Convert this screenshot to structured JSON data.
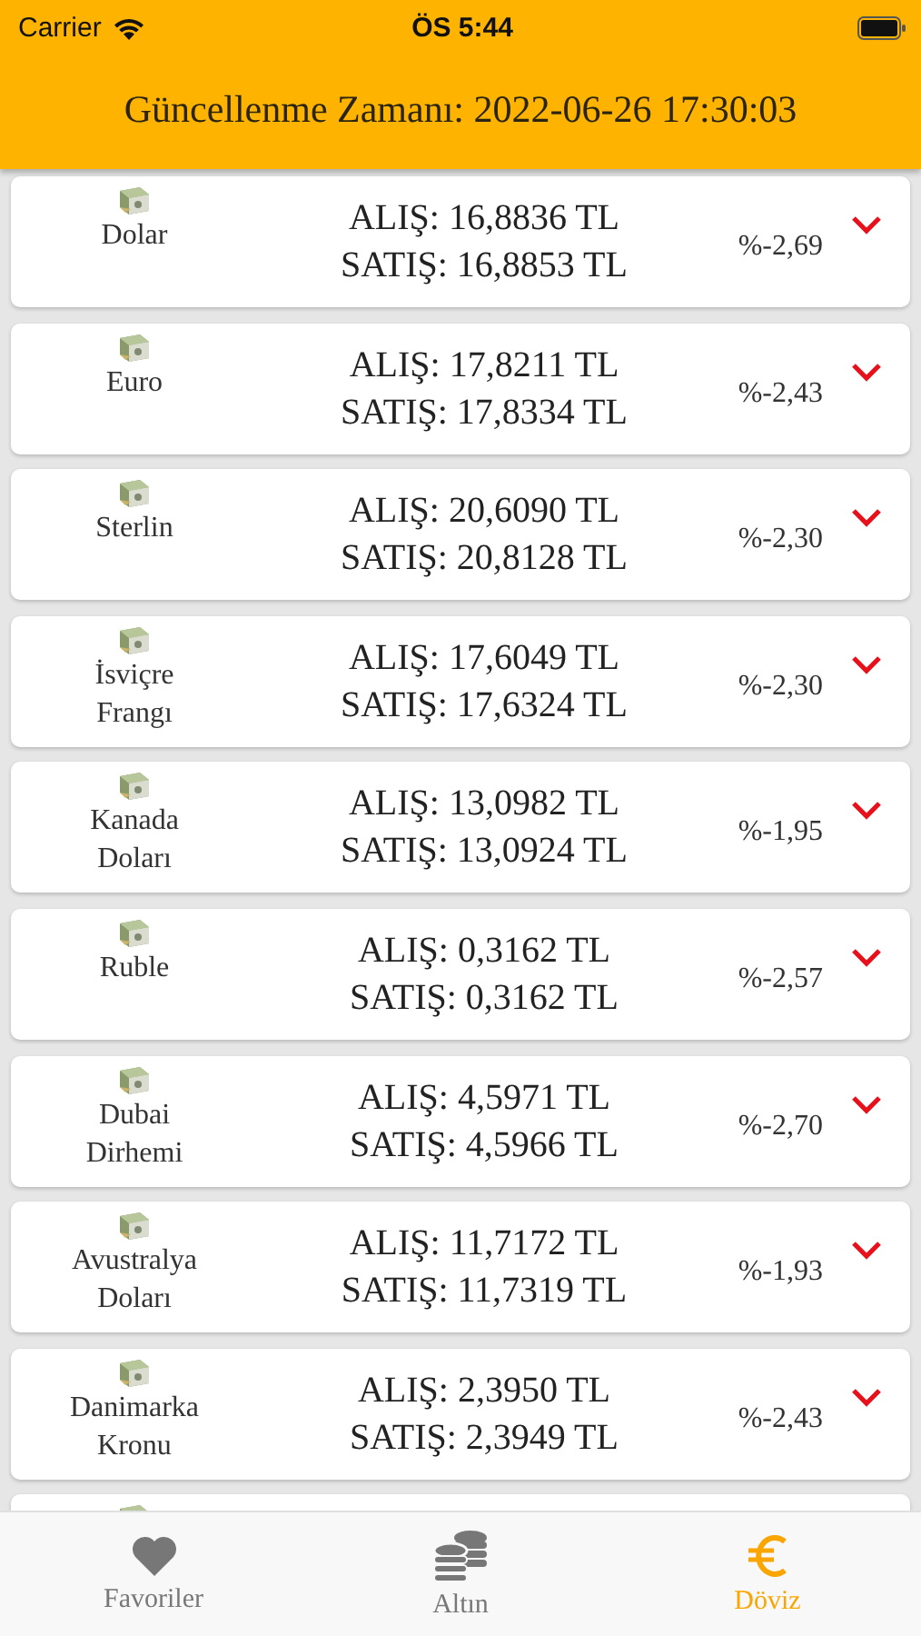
{
  "status_bar": {
    "carrier": "Carrier",
    "time": "ÖS 5:44"
  },
  "header": {
    "title": "Güncellenme Zamanı: 2022-06-26 17:30:03"
  },
  "rates": [
    {
      "name": "Dolar",
      "buy": "ALIŞ: 16,8836 TL",
      "sell": "SATIŞ: 16,8853 TL",
      "change": "%-2,69",
      "kind": "down"
    },
    {
      "name": "Euro",
      "buy": "ALIŞ: 17,8211 TL",
      "sell": "SATIŞ: 17,8334 TL",
      "change": "%-2,43",
      "kind": "down"
    },
    {
      "name": "Sterlin",
      "buy": "ALIŞ: 20,6090 TL",
      "sell": "SATIŞ: 20,8128 TL",
      "change": "%-2,30",
      "kind": "down"
    },
    {
      "name": "İsviçre Frangı",
      "buy": "ALIŞ: 17,6049 TL",
      "sell": "SATIŞ: 17,6324 TL",
      "change": "%-2,30",
      "kind": "down"
    },
    {
      "name": "Kanada Doları",
      "buy": "ALIŞ: 13,0982 TL",
      "sell": "SATIŞ: 13,0924 TL",
      "change": "%-1,95",
      "kind": "down"
    },
    {
      "name": "Ruble",
      "buy": "ALIŞ: 0,3162 TL",
      "sell": "SATIŞ: 0,3162 TL",
      "change": "%-2,57",
      "kind": "down"
    },
    {
      "name": "Dubai Dirhemi",
      "buy": "ALIŞ: 4,5971 TL",
      "sell": "SATIŞ: 4,5966 TL",
      "change": "%-2,70",
      "kind": "down"
    },
    {
      "name": "Avustralya Doları",
      "buy": "ALIŞ: 11,7172 TL",
      "sell": "SATIŞ: 11,7319 TL",
      "change": "%-1,93",
      "kind": "down"
    },
    {
      "name": "Danimarka Kronu",
      "buy": "ALIŞ: 2,3950 TL",
      "sell": "SATIŞ: 2,3949 TL",
      "change": "%-2,43",
      "kind": "down"
    }
  ],
  "tabs": [
    {
      "label": "Favoriler",
      "selected": false
    },
    {
      "label": "Altın",
      "selected": false
    },
    {
      "label": "Döviz",
      "selected": true
    }
  ]
}
